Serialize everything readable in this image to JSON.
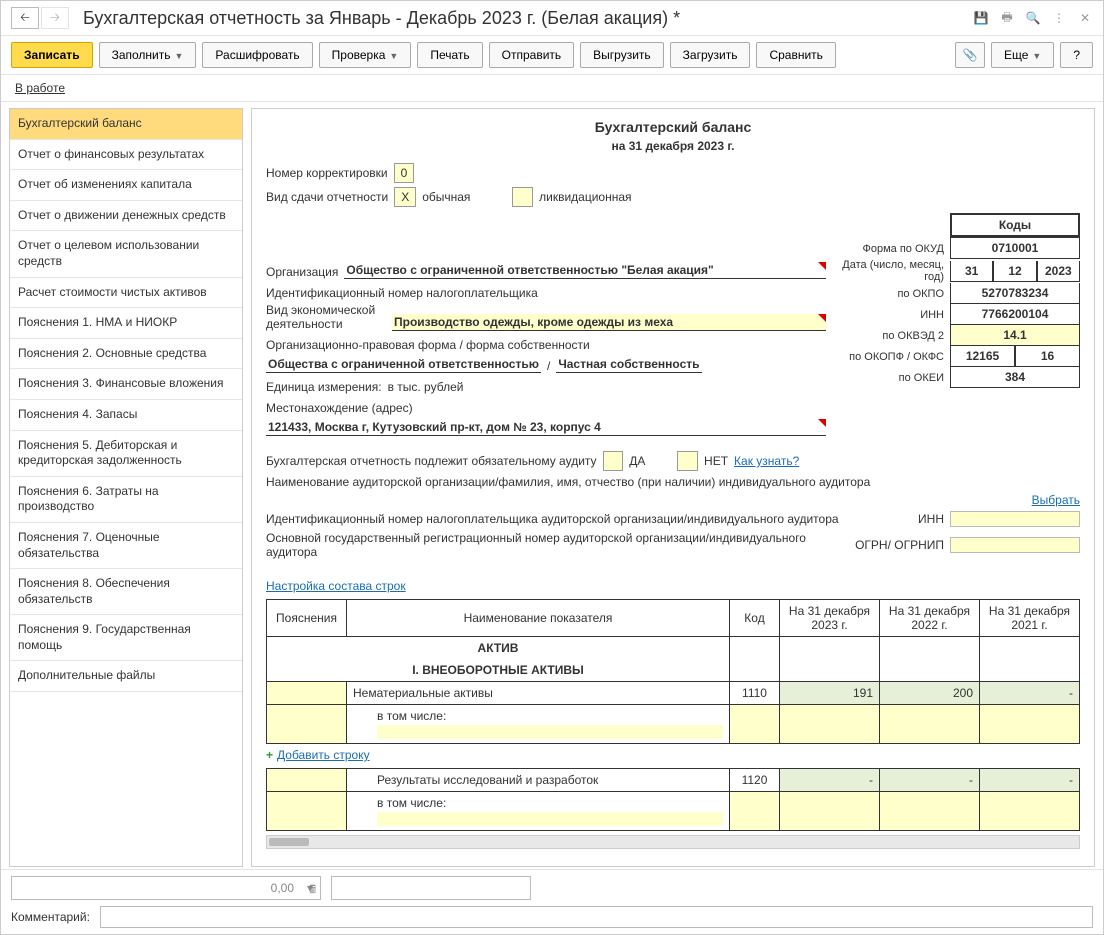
{
  "titlebar": {
    "title": "Бухгалтерская отчетность за Январь - Декабрь 2023 г. (Белая акация) *"
  },
  "toolbar": {
    "write": "Записать",
    "fill": "Заполнить",
    "decode": "Расшифровать",
    "check": "Проверка",
    "print": "Печать",
    "send": "Отправить",
    "export": "Выгрузить",
    "import": "Загрузить",
    "compare": "Сравнить",
    "more": "Еще"
  },
  "status": "В работе",
  "sidebar": {
    "items": [
      "Бухгалтерский баланс",
      "Отчет о финансовых результатах",
      "Отчет об изменениях капитала",
      "Отчет о движении денежных средств",
      "Отчет о целевом использовании средств",
      "Расчет стоимости чистых активов",
      "Пояснения 1. НМА и НИОКР",
      "Пояснения 2. Основные средства",
      "Пояснения 3. Финансовые вложения",
      "Пояснения 4. Запасы",
      "Пояснения 5. Дебиторская и кредиторская задолженность",
      "Пояснения 6. Затраты на производство",
      "Пояснения 7. Оценочные обязательства",
      "Пояснения 8. Обеспечения обязательств",
      "Пояснения 9. Государственная помощь",
      "Дополнительные файлы"
    ]
  },
  "form": {
    "title": "Бухгалтерский баланс",
    "subtitle": "на 31 декабря 2023 г.",
    "corr_label": "Номер корректировки",
    "corr_value": "0",
    "type_label": "Вид сдачи отчетности",
    "type_mark": "X",
    "type_normal": "обычная",
    "type_liquid": "ликвидационная",
    "codes_header": "Коды",
    "okud_label": "Форма по ОКУД",
    "okud": "0710001",
    "date_label": "Дата (число, месяц, год)",
    "date_d": "31",
    "date_m": "12",
    "date_y": "2023",
    "org_label": "Организация",
    "org_name": "Общество с ограниченной ответственностью \"Белая акация\"",
    "okpo_label": "по ОКПО",
    "okpo": "5270783234",
    "inn_label_full": "Идентификационный номер налогоплательщика",
    "inn_label": "ИНН",
    "inn": "7766200104",
    "activity_label": "Вид экономической деятельности",
    "activity": "Производство одежды, кроме одежды из меха",
    "okved_label": "по ОКВЭД 2",
    "okved": "14.1",
    "orgform_label": "Организационно-правовая форма / форма собственности",
    "orgform1": "Общества с ограниченной ответственностью",
    "orgform2": "Частная собственность",
    "okopf_label": "по ОКОПФ / ОКФС",
    "okopf1": "12165",
    "okopf2": "16",
    "unit_label": "Единица измерения:",
    "unit": "в тыс. рублей",
    "okei_label": "по ОКЕИ",
    "okei": "384",
    "addr_label": "Местонахождение (адрес)",
    "addr": "121433, Москва г, Кутузовский пр-кт, дом № 23, корпус 4",
    "audit_label": "Бухгалтерская отчетность подлежит обязательному аудиту",
    "audit_yes": "ДА",
    "audit_no": "НЕТ",
    "audit_link": "Как узнать?",
    "audit_org_label": "Наименование аудиторской организации/фамилия, имя, отчество (при наличии) индивидуального аудитора",
    "choose": "Выбрать",
    "audit_inn_label": "Идентификационный номер налогоплательщика аудиторской организации/индивидуального аудитора",
    "audit_inn_short": "ИНН",
    "audit_ogrn_label": "Основной государственный регистрационный номер аудиторской организации/индивидуального аудитора",
    "audit_ogrn_short": "ОГРН/ ОГРНИП",
    "config_link": "Настройка состава строк",
    "add_row": "Добавить строку"
  },
  "table": {
    "h_expl": "Пояснения",
    "h_name": "Наименование показателя",
    "h_code": "Код",
    "h_c1": "На 31 декабря 2023 г.",
    "h_c2": "На 31 декабря 2022 г.",
    "h_c3": "На 31 декабря 2021 г.",
    "sec_aktiv": "АКТИВ",
    "sec_vneob": "I. ВНЕОБОРОТНЫЕ АКТИВЫ",
    "r1_name": "Нематериальные активы",
    "r1_code": "1110",
    "r1_v1": "191",
    "r1_v2": "200",
    "r1_v3": "-",
    "r_incl": "в том числе:",
    "r2_name": "Результаты исследований и разработок",
    "r2_code": "1120",
    "r2_v1": "-",
    "r2_v2": "-",
    "r2_v3": "-"
  },
  "footer": {
    "num": "0,00",
    "comment_label": "Комментарий:"
  }
}
